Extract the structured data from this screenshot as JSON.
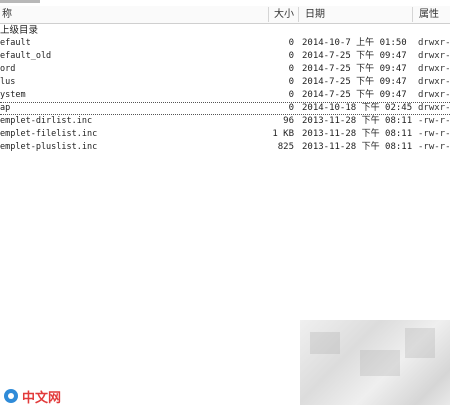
{
  "header": {
    "name_label": "称",
    "size_label": "大小",
    "date_label": "日期",
    "attr_label": "属性"
  },
  "parent_label": "上级目录",
  "rows": [
    {
      "name": "efault",
      "size": "0",
      "date": "2014-10-7 上午 01:50",
      "attr": "drwxr-x"
    },
    {
      "name": "efault_old",
      "size": "0",
      "date": "2014-7-25 下午 09:47",
      "attr": "drwxr-x"
    },
    {
      "name": "ord",
      "size": "0",
      "date": "2014-7-25 下午 09:47",
      "attr": "drwxr-x"
    },
    {
      "name": "lus",
      "size": "0",
      "date": "2014-7-25 下午 09:47",
      "attr": "drwxr-x"
    },
    {
      "name": "ystem",
      "size": "0",
      "date": "2014-7-25 下午 09:47",
      "attr": "drwxr-x"
    },
    {
      "name": "ap",
      "size": "0",
      "date": "2014-10-18 下午 02:45",
      "attr": "drwxr-x",
      "selected": true
    },
    {
      "name": "emplet-dirlist.inc",
      "size": "96",
      "date": "2013-11-28 下午 08:11",
      "attr": "-rw-r--"
    },
    {
      "name": "emplet-filelist.inc",
      "size": "1 KB",
      "date": "2013-11-28 下午 08:11",
      "attr": "-rw-r--"
    },
    {
      "name": "emplet-pluslist.inc",
      "size": "825",
      "date": "2013-11-28 下午 08:11",
      "attr": "-rw-r--"
    }
  ],
  "watermark": {
    "text": "中文网"
  }
}
